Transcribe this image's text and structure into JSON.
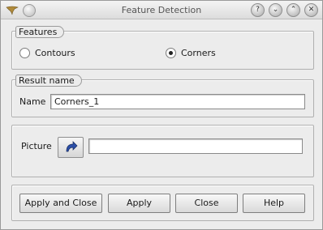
{
  "window": {
    "title": "Feature Detection"
  },
  "features": {
    "label": "Features",
    "options": [
      {
        "label": "Contours",
        "selected": false
      },
      {
        "label": "Corners",
        "selected": true
      }
    ]
  },
  "result": {
    "label": "Result name",
    "name_label": "Name",
    "name_value": "Corners_1"
  },
  "picture": {
    "label": "Picture",
    "value": ""
  },
  "buttons": {
    "apply_close": "Apply and Close",
    "apply": "Apply",
    "close": "Close",
    "help": "Help"
  },
  "icons": {
    "app": "wing-icon",
    "help": "help-icon",
    "minimize": "minimize-icon",
    "maximize": "maximize-icon",
    "close": "close-icon",
    "select": "arrow-icon"
  }
}
